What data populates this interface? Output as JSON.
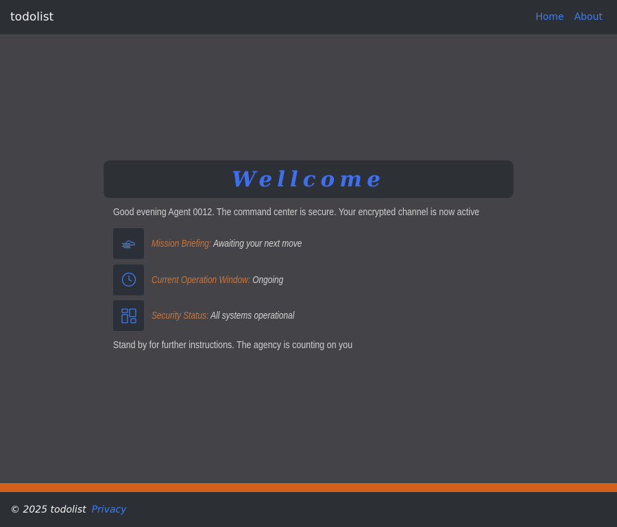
{
  "navbar": {
    "brand": "todolist",
    "links": [
      {
        "label": "Home"
      },
      {
        "label": "About"
      }
    ]
  },
  "welcome": {
    "title": "Wellcome",
    "greeting": "Good evening Agent 0012. The command center is secure. Your encrypted channel is now active"
  },
  "status_rows": [
    {
      "icon": "cloud-wind-icon",
      "label": "Mission Briefing:",
      "value": "Awaiting your next move"
    },
    {
      "icon": "clock-icon",
      "label": "Current Operation Window:",
      "value": "Ongoing"
    },
    {
      "icon": "dashboard-icon",
      "label": "Security Status:",
      "value": "All systems operational"
    }
  ],
  "standby": "Stand by for further instructions. The agency is counting on you",
  "footer": {
    "copyright": "© 2025 todolist",
    "privacy": "Privacy"
  },
  "colors": {
    "accent": "#3b7df5",
    "label": "#c9763c",
    "footer_bar": "#d35f1d",
    "background": "#444348",
    "panel": "#2c2f34"
  }
}
